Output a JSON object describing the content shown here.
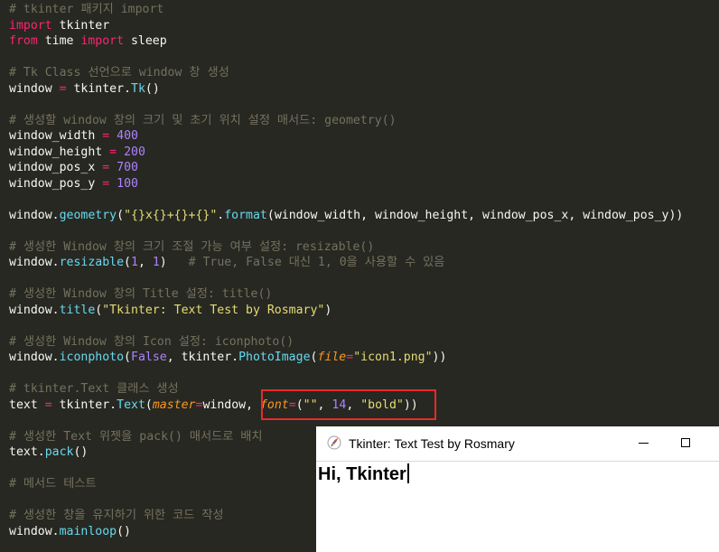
{
  "code": {
    "l1": "# tkinter 패키지 import",
    "l2_kw": "import",
    "l2_mod": " tkinter",
    "l3_from": "from",
    "l3_mod": " time ",
    "l3_import": "import",
    "l3_name": " sleep",
    "l5": "# Tk Class 선언으로 window 창 생성",
    "l6_var": "window ",
    "l6_eq": "=",
    "l6_mod": " tkinter.",
    "l6_fn": "Tk",
    "l6_end": "()",
    "l8": "# 생성할 window 창의 크기 및 초기 위치 설정 매서드: geometry()",
    "l9_var": "window_width ",
    "l9_val": "400",
    "l10_var": "window_height ",
    "l10_val": "200",
    "l11_var": "window_pos_x ",
    "l11_val": "700",
    "l12_var": "window_pos_y ",
    "l12_val": "100",
    "eq": "=",
    "sp": " ",
    "l14_obj": "window.",
    "l14_fn": "geometry",
    "l14_paren": "(",
    "l14_str": "\"{}x{}+{}+{}\"",
    "l14_dot": ".",
    "l14_fn2": "format",
    "l14_args": "(window_width, window_height, window_pos_x, window_pos_y))",
    "l16": "# 생성한 Window 창의 크기 조절 가능 여부 설정: resizable()",
    "l17_obj": "window.",
    "l17_fn": "resizable",
    "l17_open": "(",
    "l17_n1": "1",
    "l17_comma": ", ",
    "l17_n2": "1",
    "l17_close": ")",
    "l17_comment": "   # True, False 대신 1, 0을 사용할 수 있음",
    "l19": "# 생성한 Window 창의 Title 설정: title()",
    "l20_obj": "window.",
    "l20_fn": "title",
    "l20_open": "(",
    "l20_str": "\"Tkinter: Text Test by Rosmary\"",
    "l20_close": ")",
    "l22": "# 생성한 Window 창의 Icon 설정: iconphoto()",
    "l23_obj": "window.",
    "l23_fn": "iconphoto",
    "l23_open": "(",
    "l23_false": "False",
    "l23_mid": ", tkinter.",
    "l23_fn2": "PhotoImage",
    "l23_open2": "(",
    "l23_param": "file",
    "l23_eq": "=",
    "l23_str": "\"icon1.png\"",
    "l23_close": "))",
    "l25": "# tkinter.Text 클래스 생성",
    "l26_var": "text ",
    "l26_eq": "=",
    "l26_mod": " tkinter.",
    "l26_fn": "Text",
    "l26_open": "(",
    "l26_param": "master",
    "l26_eq2": "=",
    "l26_arg": "window, ",
    "l26_param2": "font",
    "l26_eq3": "=",
    "l26_open2": "(",
    "l26_str1": "\"\"",
    "l26_comma": ", ",
    "l26_num": "14",
    "l26_comma2": ", ",
    "l26_str2": "\"bold\"",
    "l26_close": "))",
    "l28": "# 생성한 Text 위젯을 pack() 매서드로 배치",
    "l29_obj": "text.",
    "l29_fn": "pack",
    "l29_end": "()",
    "l31": "# 메서드 테스트",
    "l33": "# 생성한 창을 유지하기 위한 코드 작성",
    "l34_obj": "window.",
    "l34_fn": "mainloop",
    "l34_end": "()"
  },
  "tk_window": {
    "title": "Tkinter: Text Test by Rosmary",
    "content_text": "Hi, Tkinter"
  },
  "colors": {
    "background": "#272822",
    "comment": "#75715e",
    "keyword": "#f92672",
    "function": "#66d9ef",
    "string": "#e6db74",
    "number": "#ae81ff",
    "parameter": "#fd971f",
    "highlight_box": "#e52b2b"
  },
  "icons": {
    "tk_app_icon": "feather-icon",
    "minimize": "minimize-icon",
    "maximize": "maximize-icon"
  }
}
